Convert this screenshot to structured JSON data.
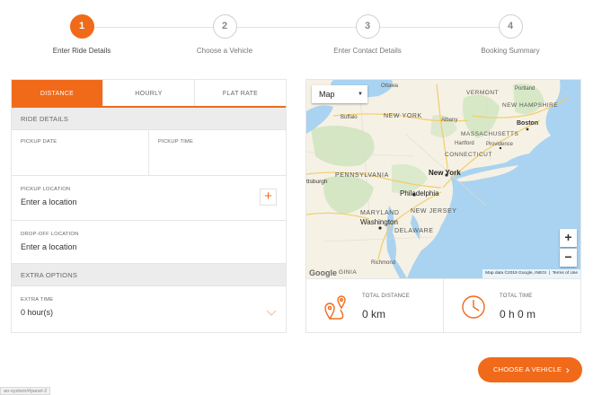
{
  "stepper": {
    "steps": [
      {
        "number": "1",
        "label": "Enter Ride Details",
        "active": true
      },
      {
        "number": "2",
        "label": "Choose a Vehicle",
        "active": false
      },
      {
        "number": "3",
        "label": "Enter Contact Details",
        "active": false
      },
      {
        "number": "4",
        "label": "Booking Summary",
        "active": false
      }
    ]
  },
  "tabs": [
    {
      "label": "DISTANCE",
      "active": true
    },
    {
      "label": "HOURLY",
      "active": false
    },
    {
      "label": "FLAT RATE",
      "active": false
    }
  ],
  "ride_details": {
    "heading": "RIDE DETAILS",
    "pickup_date_label": "PICKUP DATE",
    "pickup_time_label": "PICKUP TIME",
    "pickup_location_label": "PICKUP LOCATION",
    "pickup_location_placeholder": "Enter a location",
    "dropoff_location_label": "DROP-OFF LOCATION",
    "dropoff_location_placeholder": "Enter a location",
    "add_waypoint_symbol": "+"
  },
  "extra_options": {
    "heading": "EXTRA OPTIONS",
    "extra_time_label": "EXTRA TIME",
    "extra_time_value": "0 hour(s)"
  },
  "map": {
    "type_selector": "Map",
    "zoom_in": "+",
    "zoom_out": "−",
    "attribution": "Map data ©2019 Google, INEGI",
    "terms": "Terms of Use",
    "logo": "Google",
    "labels": {
      "ottawa": "Ottawa",
      "portland": "Portland",
      "vermont": "VERMONT",
      "new_hampshire": "NEW HAMPSHIRE",
      "buffalo": "Buffalo",
      "new_york_state": "NEW YORK",
      "albany": "Albany",
      "boston": "Boston",
      "massachusetts": "MASSACHUSETTS",
      "providence": "Providence",
      "connecticut": "CONNECTICUT",
      "hartford": "Hartford",
      "pittsburgh": "ttsburgh",
      "pennsylvania": "PENNSYLVANIA",
      "new_york_city": "New York",
      "philadelphia": "Philadelphia",
      "new_jersey": "NEW JERSEY",
      "maryland": "MARYLAND",
      "washington": "Washington",
      "delaware": "DELAWARE",
      "richmond": "Richmond",
      "virginia": "GINIA"
    }
  },
  "stats": {
    "distance_label": "TOTAL DISTANCE",
    "distance_value": "0 km",
    "time_label": "TOTAL TIME",
    "time_value": "0 h 0 m"
  },
  "cta": {
    "label": "CHOOSE A VEHICLE"
  },
  "status_bar": {
    "text": "ao-system/#panel-2"
  },
  "colors": {
    "accent": "#f06a1a",
    "water": "#a9d3f0",
    "land": "#f5f1e4"
  }
}
